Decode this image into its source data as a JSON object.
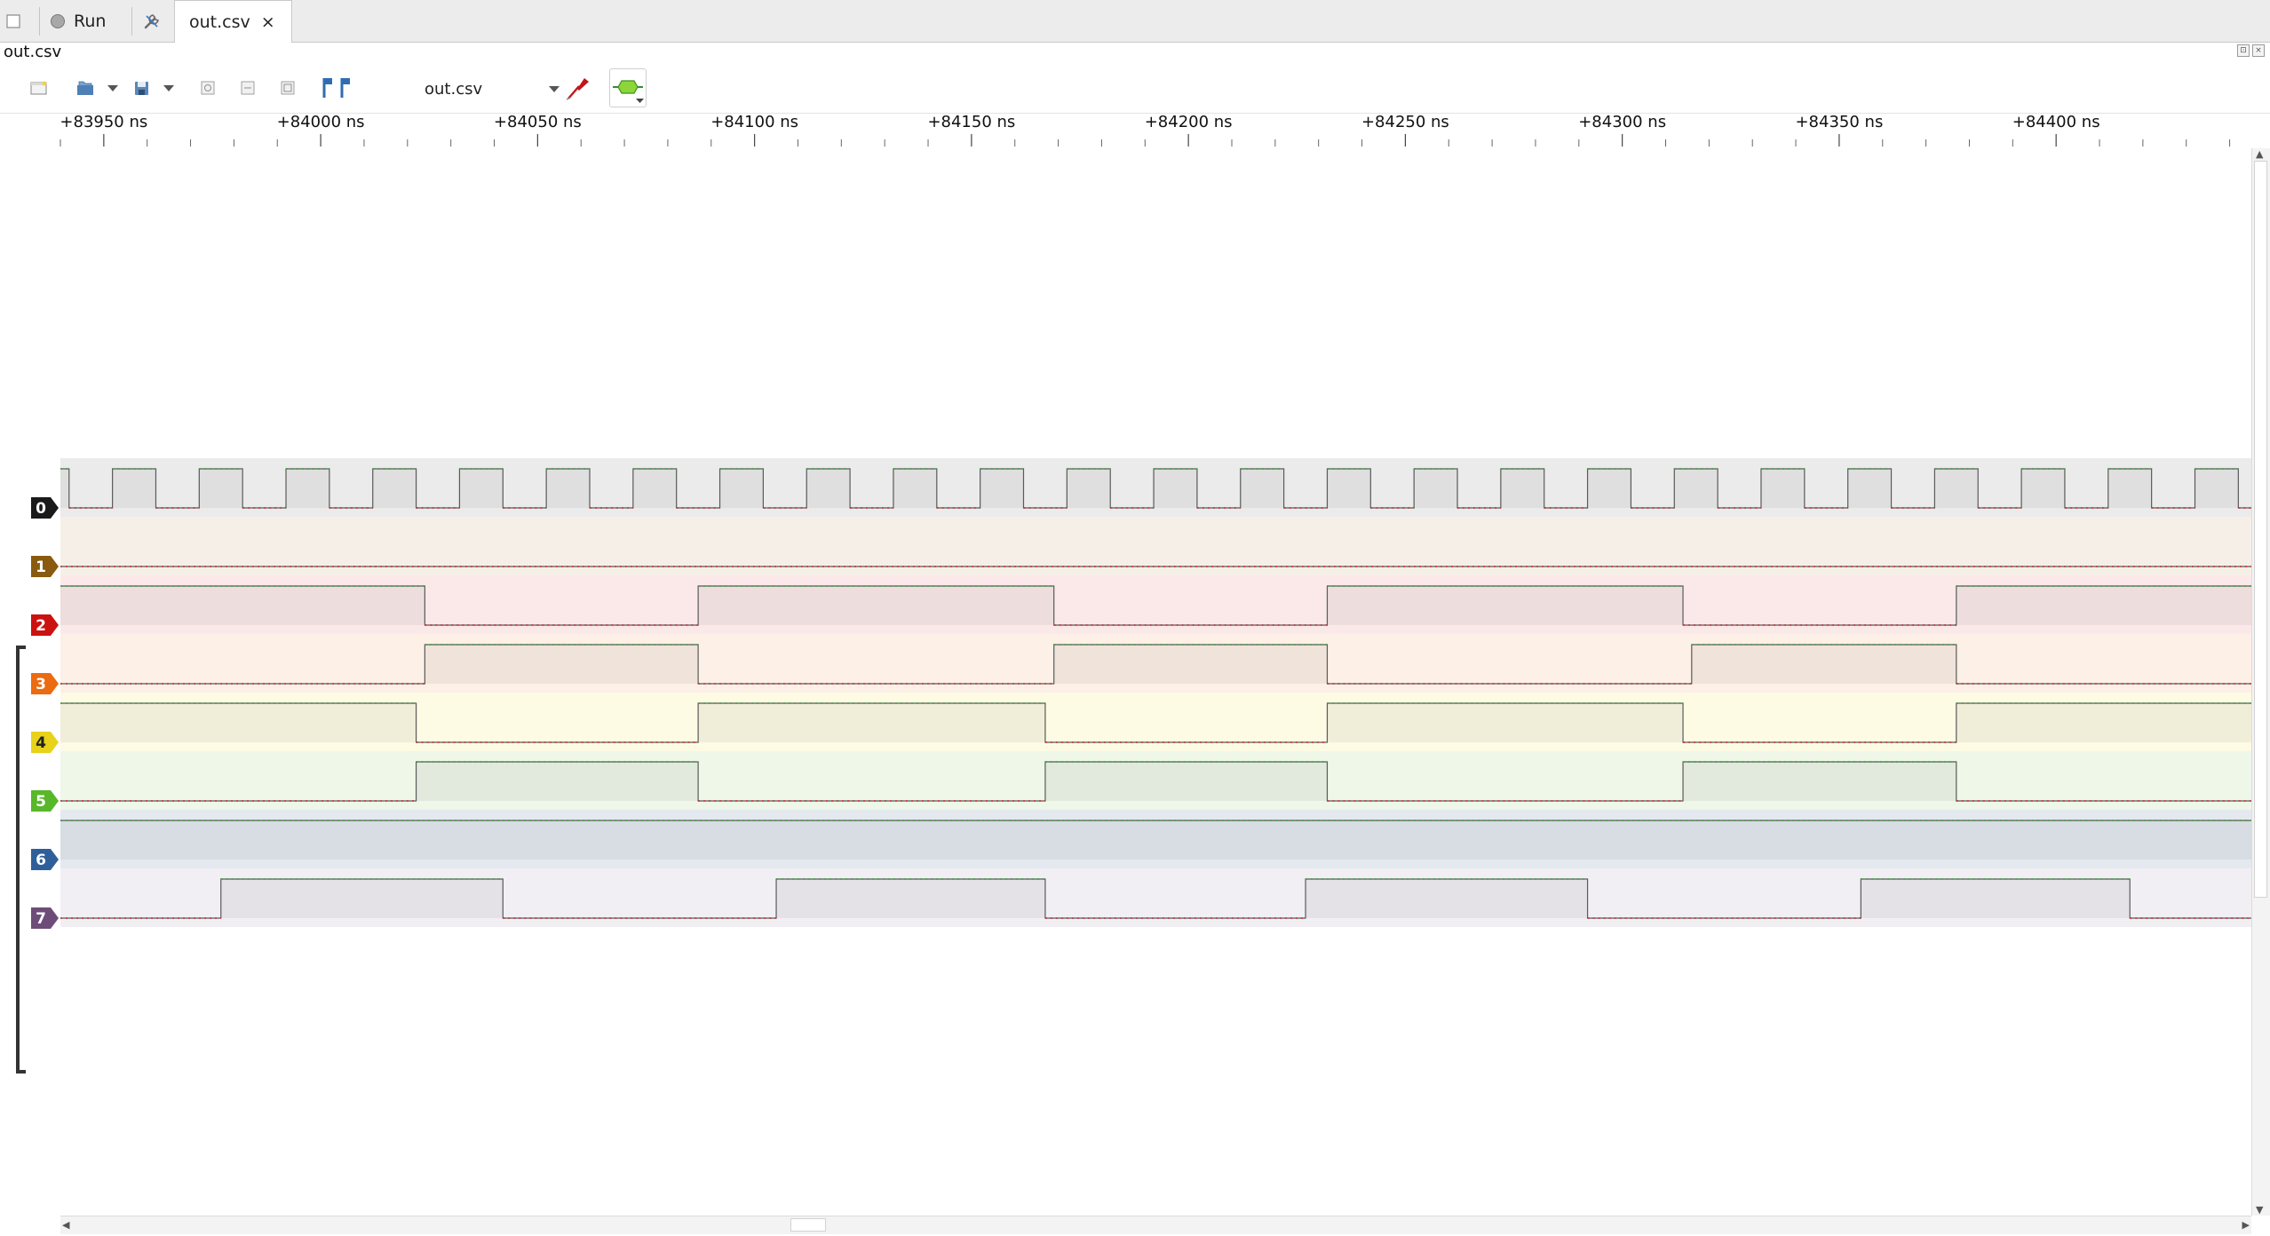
{
  "tabbar": {
    "run_label": "Run",
    "active_tab_label": "out.csv",
    "close_glyph": "×"
  },
  "document": {
    "title": "out.csv"
  },
  "toolbar": {
    "device_name": "out.csv"
  },
  "ruler": {
    "unit": "ns",
    "labels": [
      "+83950 ns",
      "+84000 ns",
      "+84050 ns",
      "+84100 ns",
      "+84150 ns",
      "+84200 ns",
      "+84250 ns",
      "+84300 ns",
      "+84350 ns",
      "+84400 ns"
    ],
    "first_label_value": 83950,
    "label_step": 50,
    "minor_ticks_per_label": 5
  },
  "waveform": {
    "view_start_ns": 83940,
    "view_end_ns": 84445,
    "channels": [
      {
        "id": "0",
        "color": "#1a1a1a",
        "bg": "#ebebeb",
        "clock": true
      },
      {
        "id": "1",
        "color": "#8a5a10",
        "bg": "#f6efe8",
        "level": 0
      },
      {
        "id": "2",
        "color": "#cc1111",
        "bg": "#fbe9e9",
        "edges_ns": [
          84024,
          84087,
          84169,
          84232,
          84314,
          84377
        ],
        "initial": 1
      },
      {
        "id": "3",
        "color": "#ec6a10",
        "bg": "#fdf0e6",
        "edges_ns": [
          84024,
          84087,
          84169,
          84232,
          84316,
          84377
        ],
        "initial": 0
      },
      {
        "id": "4",
        "color": "#e8d21a",
        "bg": "#fdfbe4",
        "edges_ns": [
          84022,
          84087,
          84167,
          84232,
          84314,
          84377
        ],
        "initial": 1
      },
      {
        "id": "5",
        "color": "#58b82a",
        "bg": "#eef7e8",
        "edges_ns": [
          84022,
          84087,
          84167,
          84232,
          84314,
          84377
        ],
        "initial": 0
      },
      {
        "id": "6",
        "color": "#2f5f9a",
        "bg": "#e4e9f0",
        "level": 1
      },
      {
        "id": "7",
        "color": "#6e4c7a",
        "bg": "#f1eff3",
        "edges_ns": [
          83977,
          84042,
          84105,
          84167,
          84227,
          84292,
          84355,
          84417
        ],
        "initial": 0
      }
    ]
  },
  "colors": {
    "high_dots": "#2ea02e",
    "low_dots": "#cc2222",
    "accent_red": "#c0161c",
    "accent_blue": "#2f6db0"
  },
  "icons": [
    "new-session-icon",
    "run-icon",
    "settings-icon",
    "open-icon",
    "save-icon",
    "zoom-in-icon",
    "zoom-out-icon",
    "zoom-fit-icon",
    "cursor-icon",
    "probe-icon",
    "decoder-icon"
  ]
}
